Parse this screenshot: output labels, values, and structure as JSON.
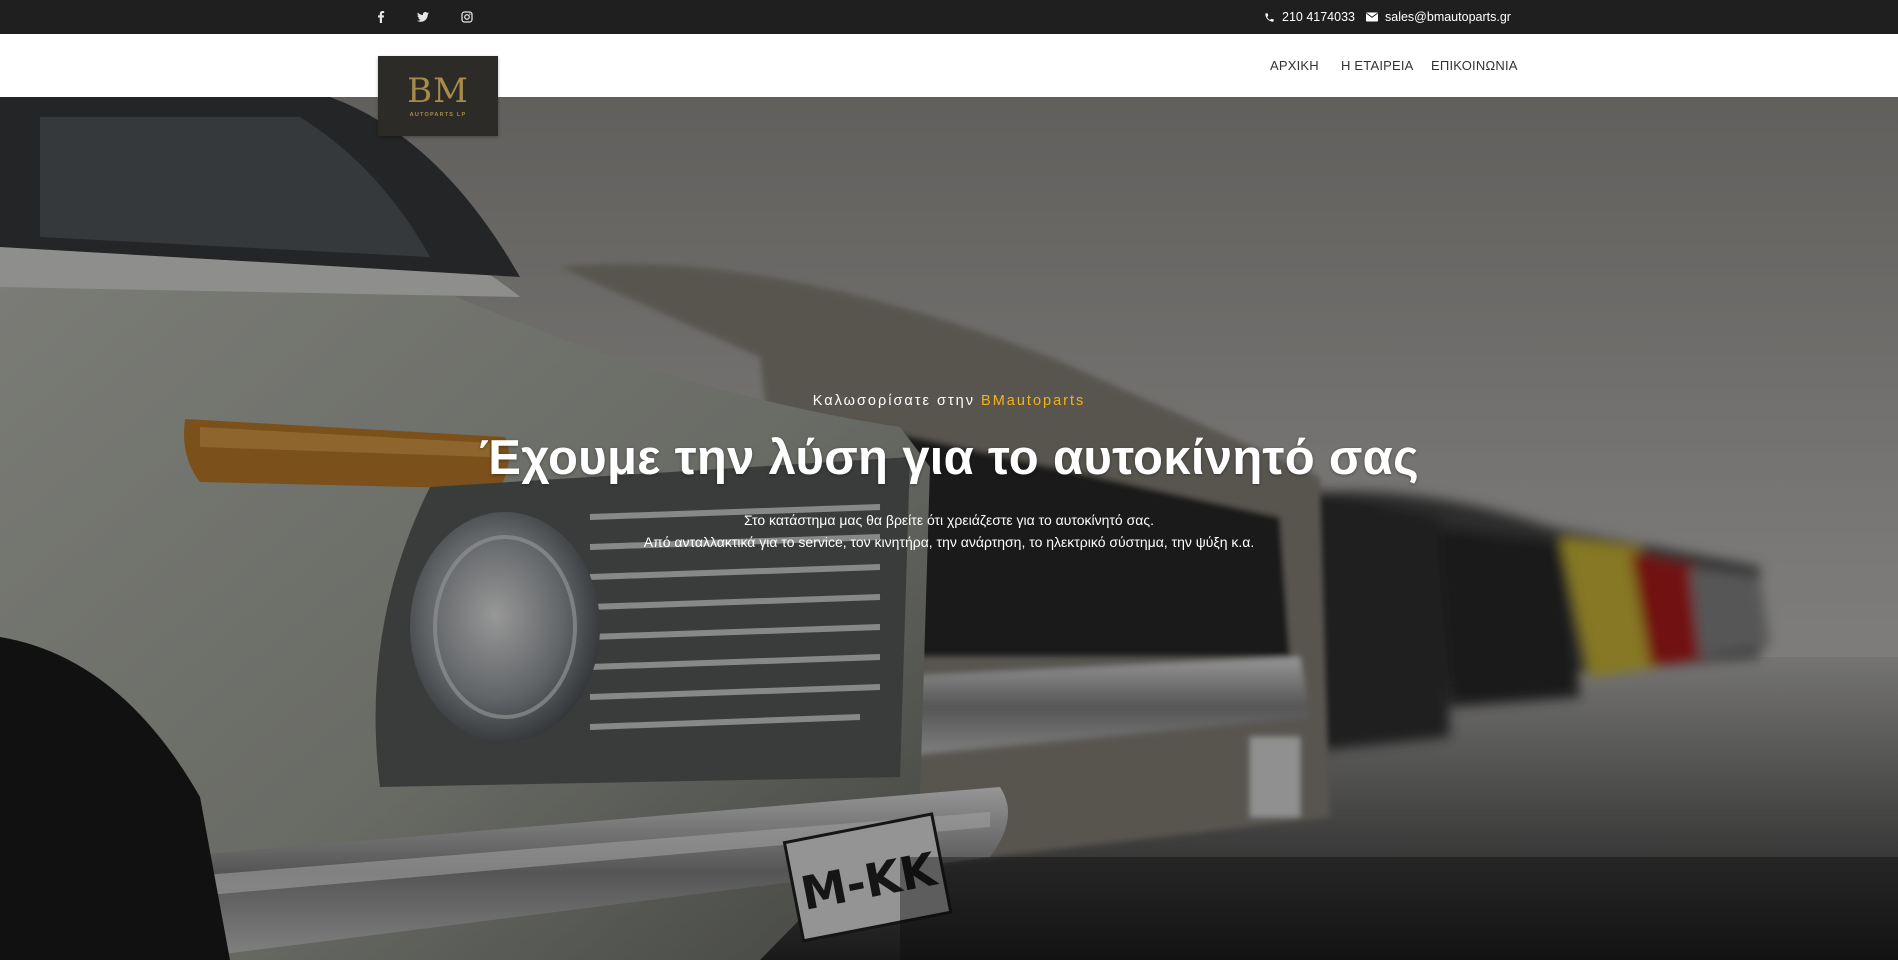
{
  "topbar": {
    "social": [
      {
        "icon": "facebook-icon"
      },
      {
        "icon": "twitter-icon"
      },
      {
        "icon": "instagram-icon"
      }
    ],
    "phone": "210 4174033",
    "email": "sales@bmautoparts.gr"
  },
  "logo": {
    "mark": "BM",
    "sub": "AUTOPARTS LP"
  },
  "nav": {
    "items": [
      "ΑΡΧΙΚΗ",
      "Η ΕΤΑΙΡΕΙΑ",
      "ΕΠΙΚΟΙΝΩΝΙΑ"
    ]
  },
  "hero": {
    "welcome_prefix": "Καλωσορίσατε στην",
    "welcome_brand": "BMautoparts",
    "headline": "Έχουμε την λύση για το αυτοκίνητό σας",
    "desc_line1": "Στο κατάστημα μας θα βρείτε ότι χρειάζεστε για το αυτοκίνητό σας.",
    "desc_line2": "Από ανταλλακτικά για το service, τον κινητήρα, την ανάρτηση, το ηλεκτρικό σύστημα, την ψύξη κ.α."
  },
  "colors": {
    "topbar_bg": "#1f1f1f",
    "accent": "#f2b21b",
    "logo_gold": "#a88a4a",
    "logo_bg": "#2d2b28"
  }
}
